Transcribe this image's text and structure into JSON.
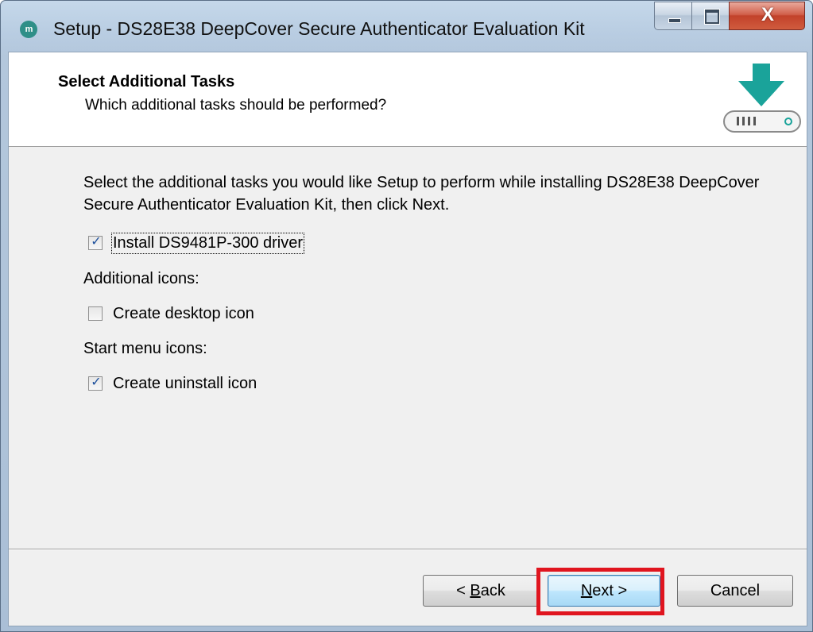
{
  "window": {
    "title": "Setup - DS28E38 DeepCover Secure Authenticator Evaluation Kit",
    "app_icon_text": "m",
    "close_glyph": "X"
  },
  "header": {
    "title": "Select Additional Tasks",
    "subtitle": "Which additional tasks should be performed?",
    "icon": "install-download-icon"
  },
  "main": {
    "intro": "Select the additional tasks you would like Setup to perform while installing DS28E38 DeepCover Secure Authenticator Evaluation Kit, then click Next.",
    "tasks": [
      {
        "label": "Install DS9481P-300 driver",
        "checked": true,
        "focused": true
      }
    ],
    "additional_icons_label": "Additional icons:",
    "additional_icons": [
      {
        "label": "Create desktop icon",
        "checked": false
      }
    ],
    "start_menu_label": "Start menu icons:",
    "start_menu_icons": [
      {
        "label": "Create uninstall icon",
        "checked": true
      }
    ]
  },
  "footer": {
    "back_prefix": "< ",
    "back_accel": "B",
    "back_rest": "ack",
    "next_accel": "N",
    "next_rest": "ext >",
    "cancel_label": "Cancel"
  },
  "colors": {
    "highlight": "#e0151f",
    "accent_teal": "#1aa39a",
    "check_tick": "#1c4f9c"
  }
}
